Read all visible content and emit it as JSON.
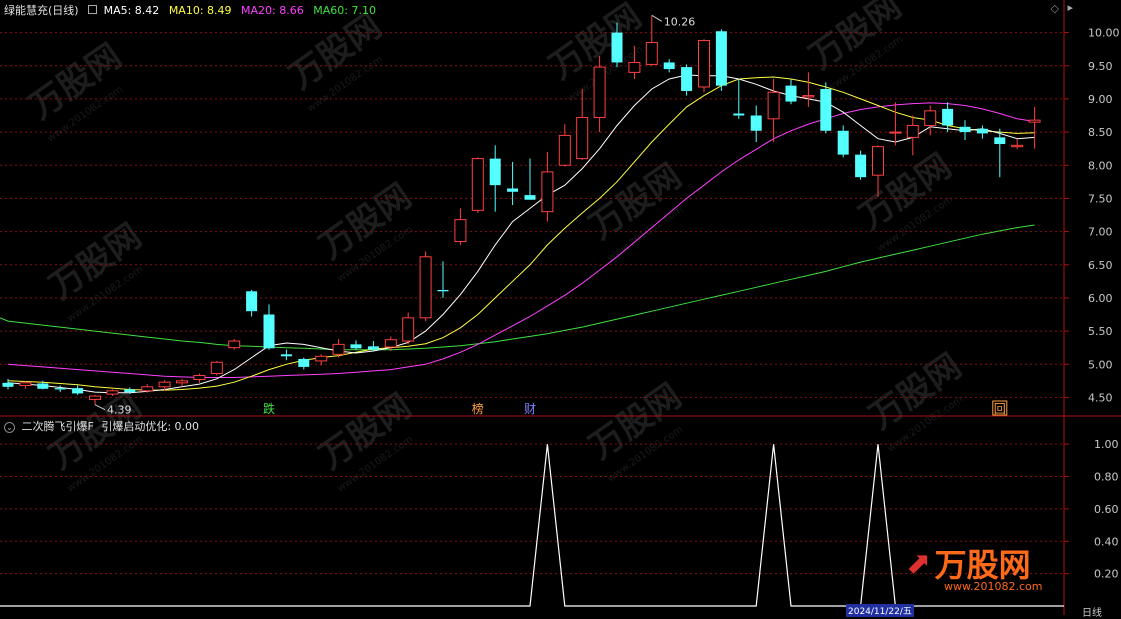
{
  "header": {
    "stock_title": "绿能慧充(日线)",
    "ma5": "MA5: 8.42",
    "ma10": "MA10: 8.49",
    "ma20": "MA20: 8.66",
    "ma60": "MA60: 7.10",
    "indicator_title": "二次腾飞引爆F",
    "indicator_value": "引爆启动优化: 0.00"
  },
  "colors": {
    "bg": "#000000",
    "up": "#ff4040",
    "down": "#54ffff",
    "ma5": "#ffffff",
    "ma10": "#ffff40",
    "ma20": "#ff40ff",
    "ma60": "#40e040",
    "grid": "#8b1010",
    "axis_text": "#c8c8c8"
  },
  "markers": {
    "high_label": "10.26",
    "low_label": "4.39",
    "tags": [
      {
        "label": "跌",
        "color": "#40e040"
      },
      {
        "label": "榜",
        "color": "#ffa040"
      },
      {
        "label": "财",
        "color": "#8080ff"
      },
      {
        "label": "回",
        "color": "#ffa040"
      }
    ]
  },
  "bottom_axis": {
    "date_label": "2024/11/22/五",
    "period_label": "日线"
  },
  "watermark": {
    "brand": "万股网",
    "url": "www.201082.com"
  },
  "chart_data": [
    {
      "type": "candlestick",
      "title": "绿能慧充(日线)",
      "ylim": [
        4.25,
        10.25
      ],
      "y_ticks": [
        4.5,
        5.0,
        5.5,
        6.0,
        6.5,
        7.0,
        7.5,
        8.0,
        8.5,
        9.0,
        9.5,
        10.0
      ],
      "y_tick_labels": [
        "4.50",
        "5.00",
        "5.50",
        "6.00",
        "6.50",
        "7.00",
        "7.50",
        "8.00",
        "8.50",
        "9.00",
        "9.50",
        "10.00"
      ],
      "candles": [
        {
          "o": 4.72,
          "h": 4.78,
          "l": 4.62,
          "c": 4.66
        },
        {
          "o": 4.68,
          "h": 4.75,
          "l": 4.63,
          "c": 4.72
        },
        {
          "o": 4.71,
          "h": 4.75,
          "l": 4.62,
          "c": 4.63
        },
        {
          "o": 4.64,
          "h": 4.68,
          "l": 4.58,
          "c": 4.62
        },
        {
          "o": 4.64,
          "h": 4.68,
          "l": 4.54,
          "c": 4.56
        },
        {
          "o": 4.47,
          "h": 4.54,
          "l": 4.39,
          "c": 4.52
        },
        {
          "o": 4.55,
          "h": 4.62,
          "l": 4.52,
          "c": 4.6
        },
        {
          "o": 4.62,
          "h": 4.65,
          "l": 4.55,
          "c": 4.58
        },
        {
          "o": 4.6,
          "h": 4.7,
          "l": 4.57,
          "c": 4.66
        },
        {
          "o": 4.66,
          "h": 4.76,
          "l": 4.6,
          "c": 4.73
        },
        {
          "o": 4.72,
          "h": 4.78,
          "l": 4.66,
          "c": 4.75
        },
        {
          "o": 4.77,
          "h": 4.86,
          "l": 4.72,
          "c": 4.83
        },
        {
          "o": 4.86,
          "h": 5.05,
          "l": 4.83,
          "c": 5.03
        },
        {
          "o": 5.25,
          "h": 5.38,
          "l": 5.22,
          "c": 5.35
        },
        {
          "o": 6.1,
          "h": 6.12,
          "l": 5.72,
          "c": 5.8
        },
        {
          "o": 5.75,
          "h": 5.9,
          "l": 5.22,
          "c": 5.24
        },
        {
          "o": 5.15,
          "h": 5.22,
          "l": 5.06,
          "c": 5.12
        },
        {
          "o": 5.08,
          "h": 5.1,
          "l": 4.92,
          "c": 4.96
        },
        {
          "o": 5.05,
          "h": 5.15,
          "l": 4.98,
          "c": 5.12
        },
        {
          "o": 5.15,
          "h": 5.38,
          "l": 5.1,
          "c": 5.3
        },
        {
          "o": 5.3,
          "h": 5.36,
          "l": 5.22,
          "c": 5.24
        },
        {
          "o": 5.27,
          "h": 5.35,
          "l": 5.2,
          "c": 5.22
        },
        {
          "o": 5.26,
          "h": 5.42,
          "l": 5.2,
          "c": 5.37
        },
        {
          "o": 5.35,
          "h": 5.78,
          "l": 5.3,
          "c": 5.7
        },
        {
          "o": 5.7,
          "h": 6.7,
          "l": 5.65,
          "c": 6.62
        },
        {
          "o": 6.12,
          "h": 6.55,
          "l": 6.0,
          "c": 6.1
        },
        {
          "o": 6.85,
          "h": 7.35,
          "l": 6.8,
          "c": 7.18
        },
        {
          "o": 7.32,
          "h": 8.12,
          "l": 7.28,
          "c": 8.1
        },
        {
          "o": 8.1,
          "h": 8.3,
          "l": 7.3,
          "c": 7.7
        },
        {
          "o": 7.65,
          "h": 8.05,
          "l": 7.4,
          "c": 7.6
        },
        {
          "o": 7.55,
          "h": 8.1,
          "l": 7.48,
          "c": 7.48
        },
        {
          "o": 7.3,
          "h": 8.2,
          "l": 7.15,
          "c": 7.9
        },
        {
          "o": 8.0,
          "h": 8.62,
          "l": 7.98,
          "c": 8.45
        },
        {
          "o": 8.1,
          "h": 9.15,
          "l": 8.08,
          "c": 8.72
        },
        {
          "o": 8.72,
          "h": 9.65,
          "l": 8.5,
          "c": 9.48
        },
        {
          "o": 10.0,
          "h": 10.15,
          "l": 9.48,
          "c": 9.55
        },
        {
          "o": 9.4,
          "h": 9.8,
          "l": 9.3,
          "c": 9.55
        },
        {
          "o": 9.52,
          "h": 10.26,
          "l": 9.5,
          "c": 9.85
        },
        {
          "o": 9.55,
          "h": 9.6,
          "l": 9.4,
          "c": 9.45
        },
        {
          "o": 9.48,
          "h": 9.52,
          "l": 9.05,
          "c": 9.12
        },
        {
          "o": 9.18,
          "h": 9.9,
          "l": 9.1,
          "c": 9.88
        },
        {
          "o": 10.02,
          "h": 10.05,
          "l": 9.12,
          "c": 9.2
        },
        {
          "o": 8.78,
          "h": 9.3,
          "l": 8.7,
          "c": 8.75
        },
        {
          "o": 8.75,
          "h": 8.9,
          "l": 8.35,
          "c": 8.52
        },
        {
          "o": 8.7,
          "h": 9.3,
          "l": 8.35,
          "c": 9.1
        },
        {
          "o": 9.2,
          "h": 9.3,
          "l": 8.92,
          "c": 8.96
        },
        {
          "o": 9.03,
          "h": 9.4,
          "l": 8.88,
          "c": 9.05
        },
        {
          "o": 9.15,
          "h": 9.25,
          "l": 8.48,
          "c": 8.52
        },
        {
          "o": 8.52,
          "h": 8.6,
          "l": 8.12,
          "c": 8.16
        },
        {
          "o": 8.16,
          "h": 8.22,
          "l": 7.78,
          "c": 7.82
        },
        {
          "o": 7.85,
          "h": 8.3,
          "l": 7.52,
          "c": 8.28
        },
        {
          "o": 8.5,
          "h": 8.95,
          "l": 8.3,
          "c": 8.5
        },
        {
          "o": 8.42,
          "h": 8.75,
          "l": 8.15,
          "c": 8.6
        },
        {
          "o": 8.6,
          "h": 8.9,
          "l": 8.45,
          "c": 8.82
        },
        {
          "o": 8.85,
          "h": 8.95,
          "l": 8.5,
          "c": 8.6
        },
        {
          "o": 8.58,
          "h": 8.68,
          "l": 8.38,
          "c": 8.5
        },
        {
          "o": 8.55,
          "h": 8.6,
          "l": 8.4,
          "c": 8.48
        },
        {
          "o": 8.42,
          "h": 8.55,
          "l": 7.82,
          "c": 8.32
        },
        {
          "o": 8.28,
          "h": 8.4,
          "l": 8.24,
          "c": 8.3
        },
        {
          "o": 8.65,
          "h": 8.88,
          "l": 8.25,
          "c": 8.68
        }
      ],
      "ma5": [
        4.72,
        4.7,
        4.68,
        4.65,
        4.62,
        4.58,
        4.57,
        4.57,
        4.59,
        4.62,
        4.66,
        4.7,
        4.78,
        4.92,
        5.1,
        5.28,
        5.32,
        5.3,
        5.25,
        5.2,
        5.17,
        5.2,
        5.25,
        5.33,
        5.5,
        5.75,
        6.05,
        6.4,
        6.8,
        7.15,
        7.35,
        7.55,
        7.7,
        7.95,
        8.25,
        8.6,
        8.9,
        9.15,
        9.3,
        9.36,
        9.35,
        9.35,
        9.3,
        9.22,
        9.12,
        9.05,
        9.0,
        8.95,
        8.8,
        8.6,
        8.4,
        8.35,
        8.42,
        8.58,
        8.55,
        8.52,
        8.55,
        8.48,
        8.4,
        8.42
      ],
      "ma10": [
        4.75,
        4.74,
        4.73,
        4.71,
        4.69,
        4.66,
        4.64,
        4.62,
        4.61,
        4.61,
        4.62,
        4.64,
        4.67,
        4.73,
        4.82,
        4.92,
        5.0,
        5.06,
        5.1,
        5.13,
        5.18,
        5.23,
        5.25,
        5.27,
        5.31,
        5.4,
        5.55,
        5.75,
        6.0,
        6.25,
        6.5,
        6.8,
        7.05,
        7.28,
        7.5,
        7.75,
        8.05,
        8.35,
        8.62,
        8.88,
        9.05,
        9.2,
        9.3,
        9.32,
        9.33,
        9.3,
        9.25,
        9.18,
        9.1,
        9.0,
        8.9,
        8.8,
        8.72,
        8.68,
        8.6,
        8.55,
        8.52,
        8.5,
        8.48,
        8.49
      ],
      "ma20": [
        5.0,
        4.98,
        4.96,
        4.94,
        4.92,
        4.9,
        4.88,
        4.86,
        4.84,
        4.82,
        4.81,
        4.8,
        4.8,
        4.8,
        4.81,
        4.82,
        4.83,
        4.84,
        4.85,
        4.86,
        4.88,
        4.9,
        4.92,
        4.96,
        5.0,
        5.08,
        5.18,
        5.3,
        5.44,
        5.58,
        5.72,
        5.88,
        6.04,
        6.22,
        6.42,
        6.62,
        6.84,
        7.06,
        7.28,
        7.5,
        7.7,
        7.9,
        8.08,
        8.24,
        8.4,
        8.52,
        8.62,
        8.7,
        8.78,
        8.84,
        8.88,
        8.91,
        8.93,
        8.94,
        8.93,
        8.9,
        8.85,
        8.78,
        8.7,
        8.66
      ],
      "ma60": [
        5.65,
        5.62,
        5.59,
        5.56,
        5.53,
        5.5,
        5.47,
        5.44,
        5.41,
        5.38,
        5.35,
        5.33,
        5.3,
        5.28,
        5.27,
        5.26,
        5.25,
        5.24,
        5.23,
        5.22,
        5.22,
        5.22,
        5.22,
        5.23,
        5.24,
        5.26,
        5.28,
        5.31,
        5.34,
        5.38,
        5.42,
        5.46,
        5.51,
        5.56,
        5.62,
        5.68,
        5.74,
        5.8,
        5.86,
        5.92,
        5.98,
        6.04,
        6.1,
        6.16,
        6.22,
        6.28,
        6.34,
        6.4,
        6.47,
        6.54,
        6.6,
        6.66,
        6.72,
        6.78,
        6.84,
        6.9,
        6.96,
        7.01,
        7.06,
        7.1
      ]
    },
    {
      "type": "line",
      "title": "二次腾飞引爆F",
      "ylabel": "",
      "ylim": [
        0,
        1.1
      ],
      "y_ticks": [
        0.2,
        0.4,
        0.6,
        0.8,
        1.0
      ],
      "y_tick_labels": [
        "0.20",
        "0.40",
        "0.60",
        "0.80",
        "1.00"
      ],
      "spikes": [
        {
          "start": 30,
          "peak": 31,
          "end": 32,
          "value": 1.0
        },
        {
          "start": 43,
          "peak": 44,
          "end": 45,
          "value": 1.0
        },
        {
          "start": 49,
          "peak": 50,
          "end": 51,
          "value": 1.0
        }
      ]
    }
  ]
}
